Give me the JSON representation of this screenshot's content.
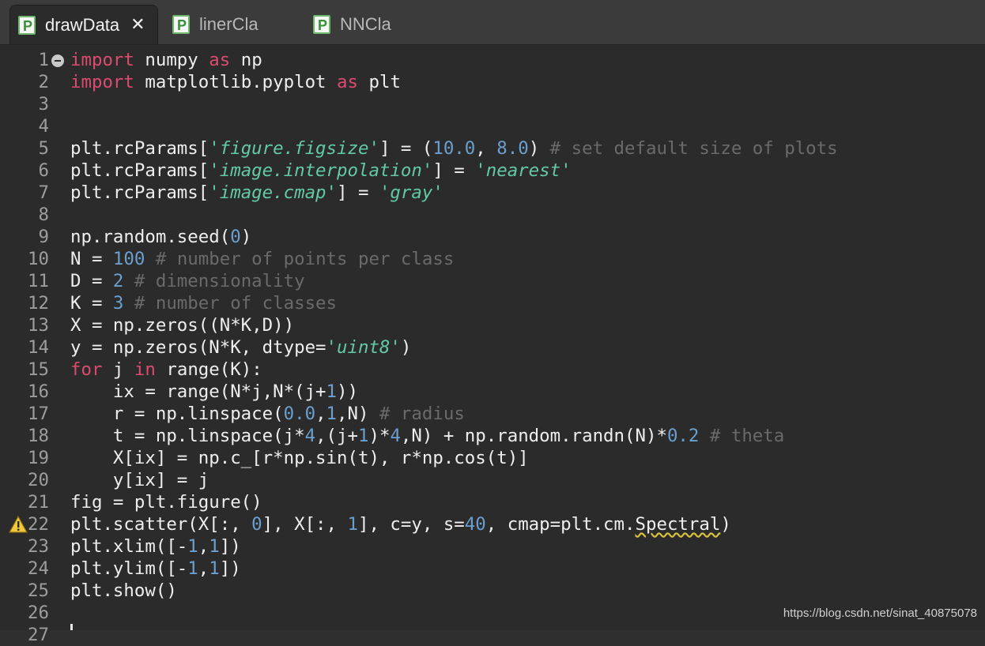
{
  "tabs": [
    {
      "label": "drawData",
      "active": true
    },
    {
      "label": "linerCla",
      "active": false
    },
    {
      "label": "NNCla",
      "active": false
    }
  ],
  "tab_icon_letter": "P",
  "close_glyph": "✕",
  "lines": [
    {
      "n": "1",
      "seg": [
        [
          "kw",
          "import"
        ],
        [
          "t",
          " numpy "
        ],
        [
          "kw",
          "as"
        ],
        [
          "t",
          " np"
        ]
      ]
    },
    {
      "n": "2",
      "seg": [
        [
          "kw",
          "import"
        ],
        [
          "t",
          " matplotlib.pyplot "
        ],
        [
          "kw",
          "as"
        ],
        [
          "t",
          " plt"
        ]
      ]
    },
    {
      "n": "3",
      "seg": []
    },
    {
      "n": "4",
      "seg": []
    },
    {
      "n": "5",
      "seg": [
        [
          "t",
          "plt.rcParams["
        ],
        [
          "str",
          "'figure.figsize'"
        ],
        [
          "t",
          "] = ("
        ],
        [
          "num",
          "10.0"
        ],
        [
          "t",
          ", "
        ],
        [
          "num",
          "8.0"
        ],
        [
          "t",
          ") "
        ],
        [
          "cmt",
          "# set default size of plots"
        ]
      ]
    },
    {
      "n": "6",
      "seg": [
        [
          "t",
          "plt.rcParams["
        ],
        [
          "str",
          "'image.interpolation'"
        ],
        [
          "t",
          "] = "
        ],
        [
          "str",
          "'nearest'"
        ]
      ]
    },
    {
      "n": "7",
      "seg": [
        [
          "t",
          "plt.rcParams["
        ],
        [
          "str",
          "'image.cmap'"
        ],
        [
          "t",
          "] = "
        ],
        [
          "str",
          "'gray'"
        ]
      ]
    },
    {
      "n": "8",
      "seg": []
    },
    {
      "n": "9",
      "seg": [
        [
          "t",
          "np.random.seed("
        ],
        [
          "num",
          "0"
        ],
        [
          "t",
          ")"
        ]
      ]
    },
    {
      "n": "10",
      "seg": [
        [
          "t",
          "N = "
        ],
        [
          "num",
          "100"
        ],
        [
          "t",
          " "
        ],
        [
          "cmt",
          "# number of points per class"
        ]
      ]
    },
    {
      "n": "11",
      "seg": [
        [
          "t",
          "D = "
        ],
        [
          "num",
          "2"
        ],
        [
          "t",
          " "
        ],
        [
          "cmt",
          "# dimensionality"
        ]
      ]
    },
    {
      "n": "12",
      "seg": [
        [
          "t",
          "K = "
        ],
        [
          "num",
          "3"
        ],
        [
          "t",
          " "
        ],
        [
          "cmt",
          "# number of classes"
        ]
      ]
    },
    {
      "n": "13",
      "seg": [
        [
          "t",
          "X = np.zeros((N*K,D))"
        ]
      ]
    },
    {
      "n": "14",
      "seg": [
        [
          "t",
          "y = np.zeros(N*K, dtype="
        ],
        [
          "str",
          "'uint8'"
        ],
        [
          "t",
          ")"
        ]
      ]
    },
    {
      "n": "15",
      "seg": [
        [
          "kw",
          "for"
        ],
        [
          "t",
          " j "
        ],
        [
          "kw",
          "in"
        ],
        [
          "t",
          " range(K):"
        ]
      ]
    },
    {
      "n": "16",
      "seg": [
        [
          "t",
          "    ix = range(N*j,N*(j+"
        ],
        [
          "num",
          "1"
        ],
        [
          "t",
          "))"
        ]
      ]
    },
    {
      "n": "17",
      "seg": [
        [
          "t",
          "    r = np.linspace("
        ],
        [
          "num",
          "0.0"
        ],
        [
          "t",
          ","
        ],
        [
          "num",
          "1"
        ],
        [
          "t",
          ",N) "
        ],
        [
          "cmt",
          "# radius"
        ]
      ]
    },
    {
      "n": "18",
      "seg": [
        [
          "t",
          "    t = np.linspace(j*"
        ],
        [
          "num",
          "4"
        ],
        [
          "t",
          ",(j+"
        ],
        [
          "num",
          "1"
        ],
        [
          "t",
          ")*"
        ],
        [
          "num",
          "4"
        ],
        [
          "t",
          ",N) + np.random.randn(N)*"
        ],
        [
          "num",
          "0.2"
        ],
        [
          "t",
          " "
        ],
        [
          "cmt",
          "# theta"
        ]
      ]
    },
    {
      "n": "19",
      "seg": [
        [
          "t",
          "    X[ix] = np.c_[r*np.sin(t), r*np.cos(t)]"
        ]
      ]
    },
    {
      "n": "20",
      "seg": [
        [
          "t",
          "    y[ix] = j"
        ]
      ]
    },
    {
      "n": "21",
      "seg": [
        [
          "t",
          "fig = plt.figure()"
        ]
      ]
    },
    {
      "n": "22",
      "seg": [
        [
          "t",
          "plt.scatter(X[:, "
        ],
        [
          "num",
          "0"
        ],
        [
          "t",
          "], X[:, "
        ],
        [
          "num",
          "1"
        ],
        [
          "t",
          "], c=y, s="
        ],
        [
          "num",
          "40"
        ],
        [
          "t",
          ", cmap=plt.cm."
        ],
        [
          "warn",
          "Spectral"
        ],
        [
          "t",
          ")"
        ]
      ]
    },
    {
      "n": "23",
      "seg": [
        [
          "t",
          "plt.xlim([-"
        ],
        [
          "num",
          "1"
        ],
        [
          "t",
          ","
        ],
        [
          "num",
          "1"
        ],
        [
          "t",
          "])"
        ]
      ]
    },
    {
      "n": "24",
      "seg": [
        [
          "t",
          "plt.ylim([-"
        ],
        [
          "num",
          "1"
        ],
        [
          "t",
          ","
        ],
        [
          "num",
          "1"
        ],
        [
          "t",
          "])"
        ]
      ]
    },
    {
      "n": "25",
      "seg": [
        [
          "t",
          "plt.show()"
        ]
      ]
    },
    {
      "n": "26",
      "seg": []
    },
    {
      "n": "27",
      "seg": []
    }
  ],
  "fold_line": "1",
  "warning_line": "22",
  "watermark": "https://blog.csdn.net/sinat_40875078",
  "colors": {
    "keyword": "#dc4b6f",
    "number": "#6a9fd0",
    "string": "#63c9a4",
    "comment": "#6a6a6a",
    "background": "#2b2b2b"
  }
}
